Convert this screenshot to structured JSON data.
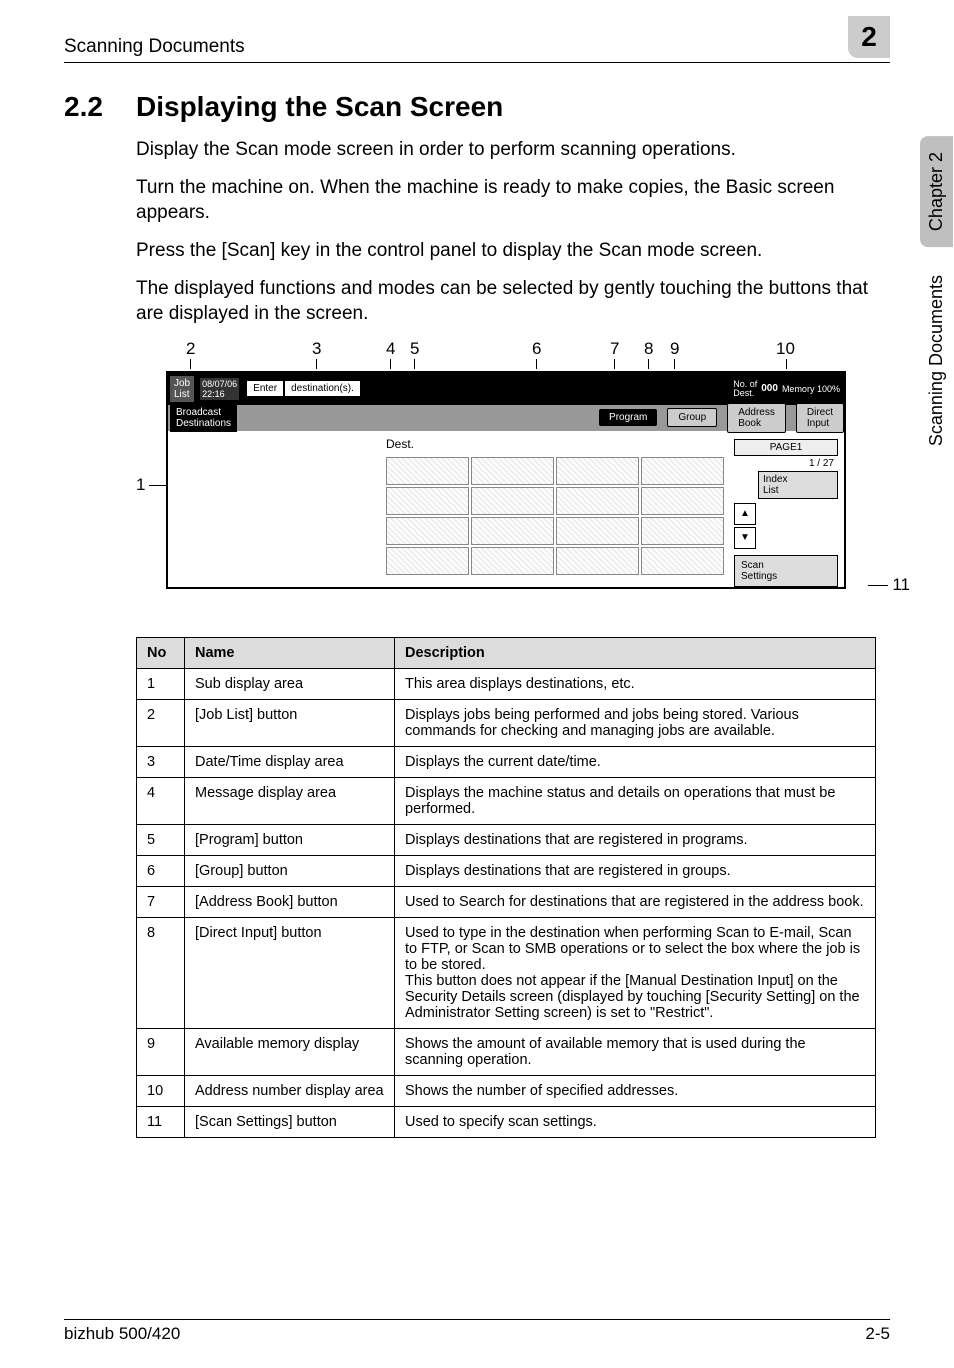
{
  "header": {
    "running": "Scanning Documents",
    "chapter_badge": "2"
  },
  "sidetab": {
    "chapter": "Chapter 2",
    "section": "Scanning Documents"
  },
  "section": {
    "number": "2.2",
    "title": "Displaying the Scan Screen"
  },
  "paragraphs": {
    "p1": "Display the Scan mode screen in order to perform scanning operations.",
    "p2": "Turn the machine on. When the machine is ready to make copies, the Basic screen appears.",
    "p3": "Press the [Scan] key in the control panel to display the Scan mode screen.",
    "p4": "The displayed functions and modes can be selected by gently touching the buttons that are displayed in the screen."
  },
  "callouts": {
    "n1": "1",
    "n2": "2",
    "n3": "3",
    "n4": "4",
    "n5": "5",
    "n6": "6",
    "n7": "7",
    "n8": "8",
    "n9": "9",
    "n10": "10",
    "n11": "11"
  },
  "screen": {
    "job_list": "Job\nList",
    "datetime": "08/07/06\n22:16",
    "enter": "Enter",
    "message": "destination(s).",
    "no_of_dest_label": "No. of\nDest.",
    "no_of_dest_value": "000",
    "memory_label": "Memory",
    "memory_value": "100%",
    "broadcast": "Broadcast\nDestinations",
    "tab_program": "Program",
    "tab_group": "Group",
    "tab_address_book": "Address\nBook",
    "tab_direct_input": "Direct\nInput",
    "dest_label": "Dest.",
    "page_label": "PAGE1",
    "page_fraction": "1 / 27",
    "index_list": "Index\nList",
    "arrow_up": "▲",
    "arrow_down": "▼",
    "scan_settings": "Scan\nSettings"
  },
  "table": {
    "head": {
      "no": "No",
      "name": "Name",
      "desc": "Description"
    },
    "rows": [
      {
        "no": "1",
        "name": "Sub display area",
        "desc": "This area displays destinations, etc."
      },
      {
        "no": "2",
        "name": "[Job List] button",
        "desc": "Displays jobs being performed and jobs being stored. Various commands for checking and managing jobs are available."
      },
      {
        "no": "3",
        "name": "Date/Time display area",
        "desc": "Displays the current date/time."
      },
      {
        "no": "4",
        "name": "Message display area",
        "desc": "Displays the machine status and details on operations that must be performed."
      },
      {
        "no": "5",
        "name": "[Program] button",
        "desc": "Displays destinations that are registered in programs."
      },
      {
        "no": "6",
        "name": "[Group] button",
        "desc": "Displays destinations that are registered in groups."
      },
      {
        "no": "7",
        "name": "[Address Book] button",
        "desc": "Used to Search for destinations that are registered in the address book."
      },
      {
        "no": "8",
        "name": "[Direct Input] button",
        "desc": "Used to type in the destination when performing Scan to E-mail, Scan to FTP, or Scan to SMB operations or to select the box where the job is to be stored.\nThis button does not appear if the [Manual Destination Input] on the Security Details screen (displayed by touching [Security Setting] on the Administrator Setting screen) is set to \"Restrict\"."
      },
      {
        "no": "9",
        "name": "Available memory display",
        "desc": "Shows the amount of available memory that is used during the scanning operation."
      },
      {
        "no": "10",
        "name": "Address number display area",
        "desc": "Shows the number of specified addresses."
      },
      {
        "no": "11",
        "name": "[Scan Settings] button",
        "desc": "Used to specify scan settings."
      }
    ]
  },
  "footer": {
    "model": "bizhub 500/420",
    "page": "2-5"
  }
}
